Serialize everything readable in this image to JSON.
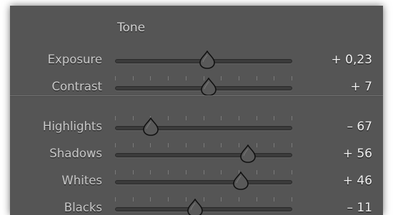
{
  "section_title": "Tone",
  "colors": {
    "panel_bg": "#555555",
    "thumb_fill": "#595959",
    "thumb_stroke": "#111111"
  },
  "sliders": [
    {
      "id": "exposure",
      "label": "Exposure",
      "value_text": "+ 0,23",
      "level": 0.52,
      "ticks": false
    },
    {
      "id": "contrast",
      "label": "Contrast",
      "value_text": "+ 7",
      "level": 0.53,
      "ticks": true
    },
    {
      "id": "highlights",
      "label": "Highlights",
      "value_text": "– 67",
      "level": 0.2,
      "ticks": true
    },
    {
      "id": "shadows",
      "label": "Shadows",
      "value_text": "+ 56",
      "level": 0.75,
      "ticks": true
    },
    {
      "id": "whites",
      "label": "Whites",
      "value_text": "+ 46",
      "level": 0.71,
      "ticks": true
    },
    {
      "id": "blacks",
      "label": "Blacks",
      "value_text": "– 11",
      "level": 0.45,
      "ticks": true
    }
  ]
}
